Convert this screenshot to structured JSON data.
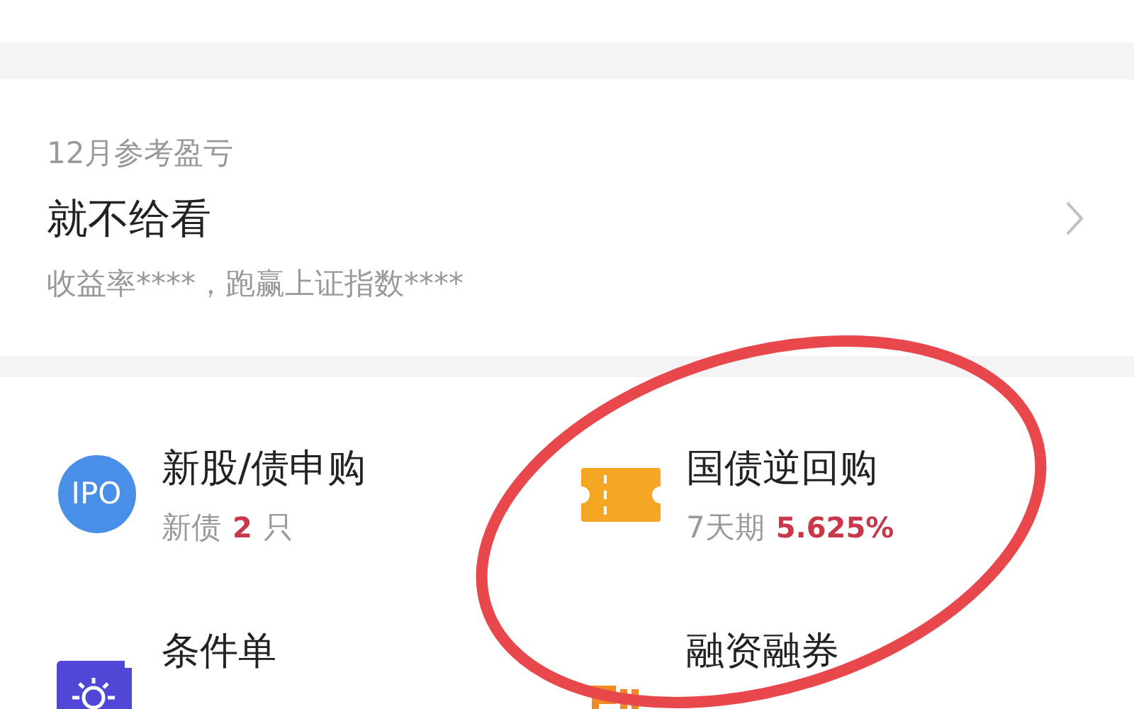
{
  "profit_card": {
    "title": "12月参考盈亏",
    "value": "就不给看",
    "subtitle": "收益率****，跑赢上证指数****"
  },
  "services": [
    {
      "kind": "ipo",
      "icon_text": "IPO",
      "title": "新股/债申购",
      "subtitle": "新债",
      "highlight": "2",
      "suffix": "只"
    },
    {
      "kind": "ticket",
      "title": "国债逆回购",
      "subtitle": "7天期",
      "highlight": "5.625%"
    },
    {
      "kind": "sun",
      "title": "条件单"
    },
    {
      "kind": "margin",
      "title": "融资融券"
    }
  ],
  "annotation": {
    "kind": "circle",
    "color": "#e8474c"
  }
}
